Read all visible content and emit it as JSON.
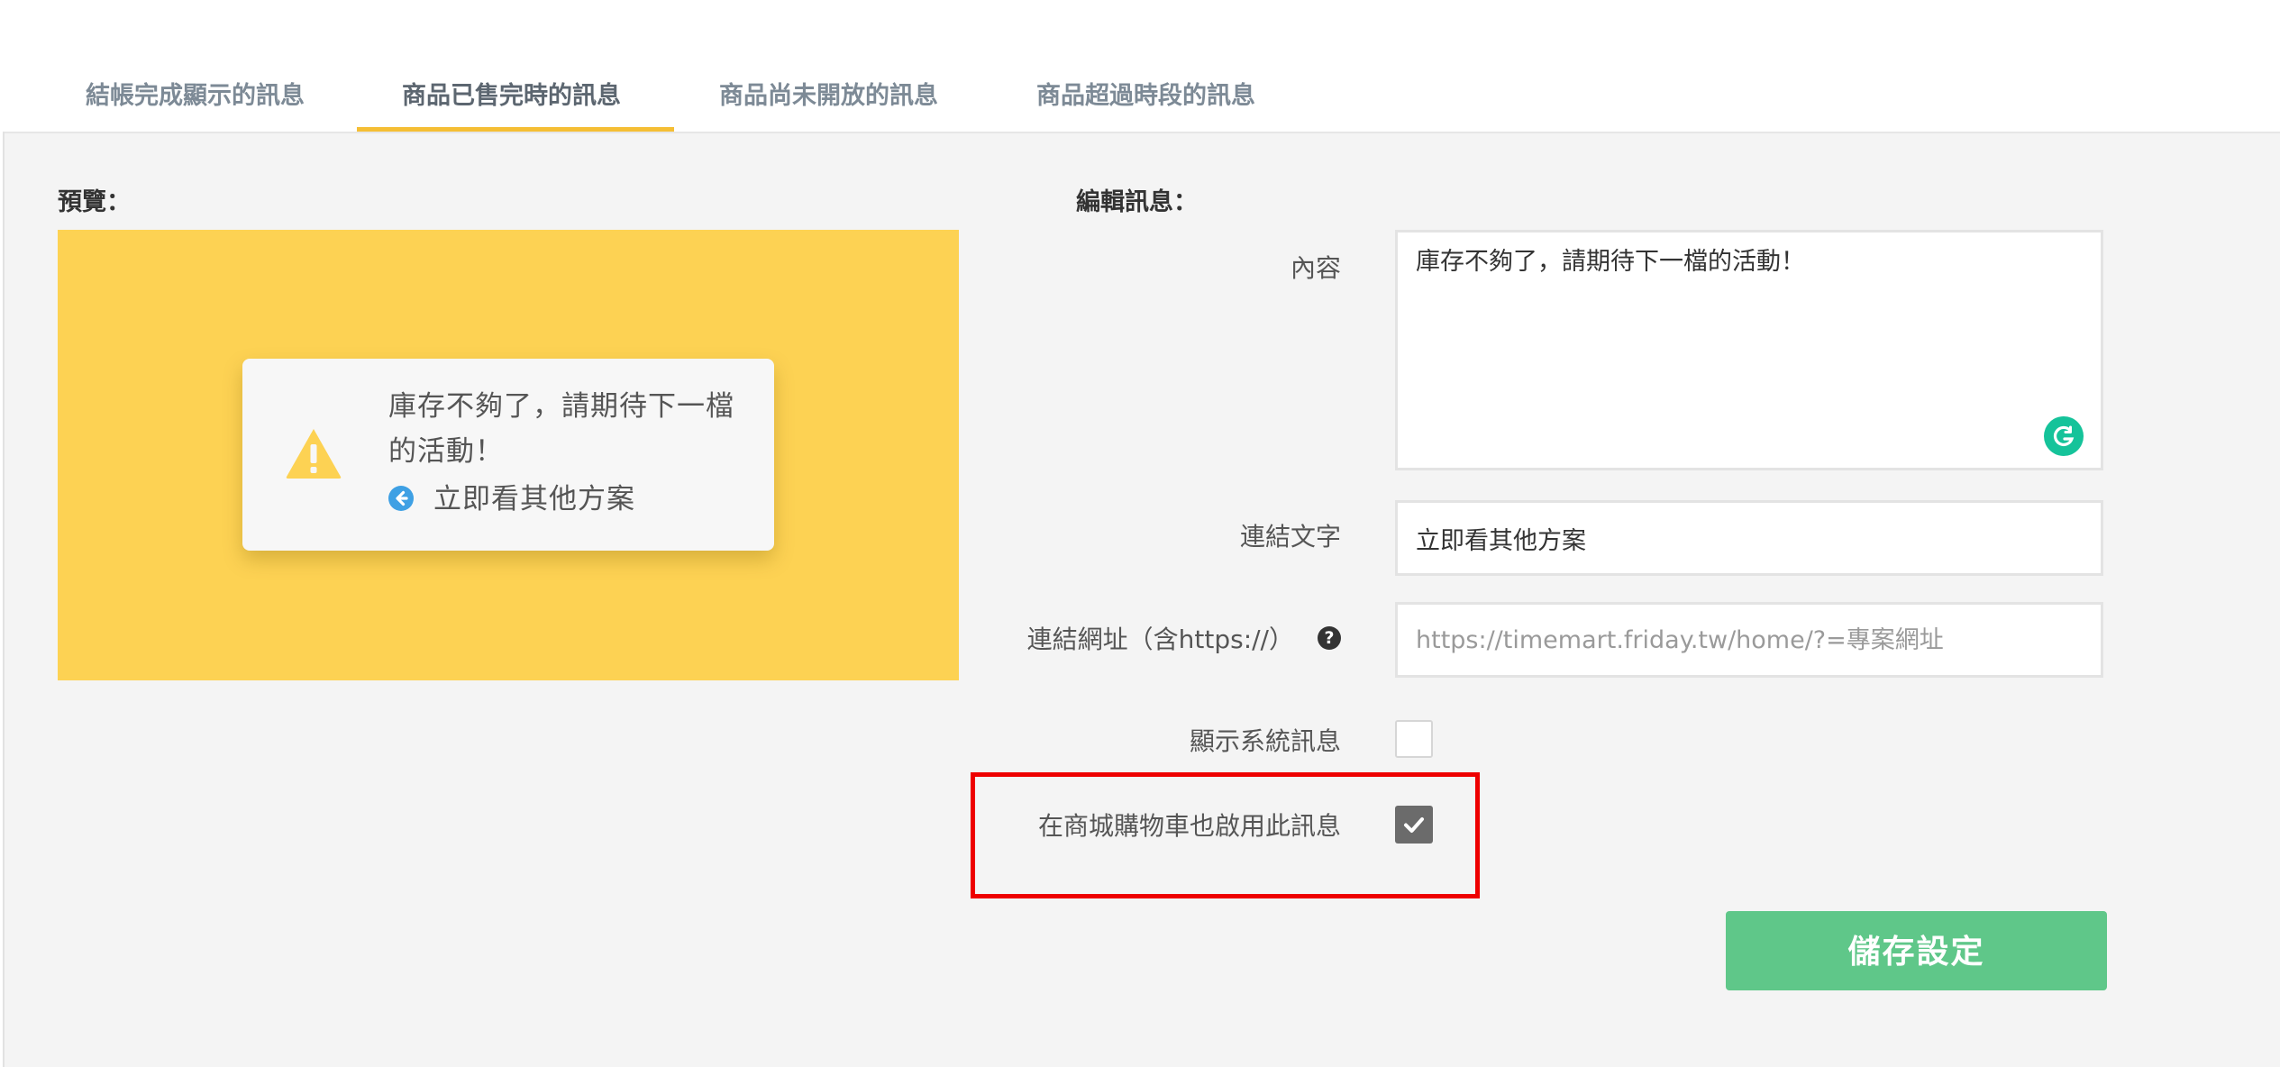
{
  "tabs": [
    {
      "label": "結帳完成顯示的訊息"
    },
    {
      "label": "商品已售完時的訊息"
    },
    {
      "label": "商品尚未開放的訊息"
    },
    {
      "label": "商品超過時段的訊息"
    }
  ],
  "active_tab_index": 1,
  "preview": {
    "heading": "預覽：",
    "message": "庫存不夠了，請期待下一檔的活動！",
    "link_text": "立即看其他方案",
    "background_color": "#fdd253",
    "warning_icon": "warning-triangle-icon",
    "link_icon": "arrow-circle-left-icon"
  },
  "editor": {
    "heading": "編輯訊息：",
    "content_label": "內容",
    "content_value": "庫存不夠了，請期待下一檔的活動！",
    "link_text_label": "連結文字",
    "link_text_value": "立即看其他方案",
    "link_url_label": "連結網址（含https://）",
    "link_url_placeholder": "https://timemart.friday.tw/home/?=專案網址",
    "link_url_help_icon": "question-circle-icon",
    "show_system_label": "顯示系統訊息",
    "show_system_checked": false,
    "cart_enable_label": "在商城購物車也啟用此訊息",
    "cart_enable_checked": true
  },
  "save_button_label": "儲存設定",
  "colors": {
    "tab_accent": "#f5be34",
    "save_button": "#5fc789",
    "highlight_box": "#ee0000"
  }
}
